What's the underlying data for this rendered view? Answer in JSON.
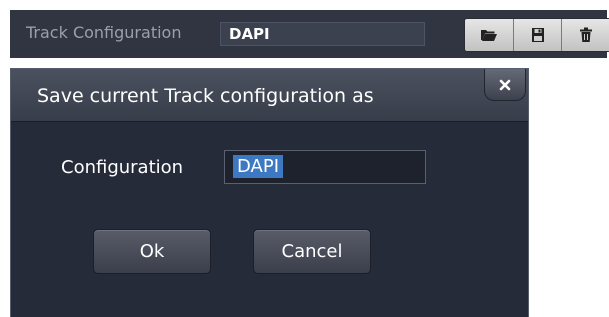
{
  "toolbar": {
    "label": "Track Configuration",
    "config_value": "DAPI",
    "buttons": [
      {
        "icon": "folder-open-icon"
      },
      {
        "icon": "save-icon"
      },
      {
        "icon": "trash-icon"
      }
    ]
  },
  "dialog": {
    "title": "Save current Track configuration as",
    "close_label": "×",
    "field_label": "Configuration",
    "field_value": "DAPI",
    "ok_label": "Ok",
    "cancel_label": "Cancel"
  },
  "colors": {
    "toolbar_bg": "#313541",
    "dialog_bg": "#262b39",
    "selection": "#3c79c2"
  }
}
